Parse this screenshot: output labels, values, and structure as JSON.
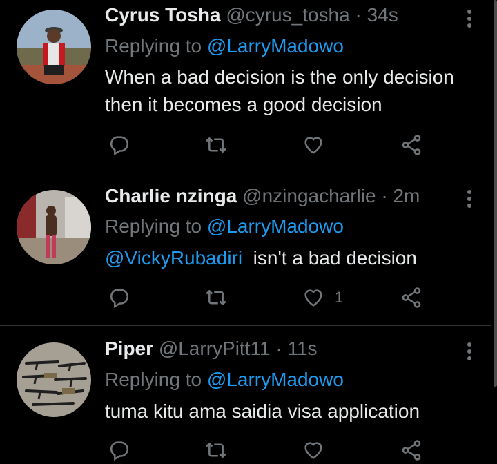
{
  "colors": {
    "accent": "#1d9bf0",
    "muted": "#71767b",
    "text": "#e7e9ea",
    "background": "#000000"
  },
  "tweets": [
    {
      "name": "Cyrus Tosha",
      "handle": "@cyrus_tosha",
      "sep": "·",
      "time": "34s",
      "reply_prefix": "Replying to",
      "reply_to": "@LarryMadowo",
      "lines": [
        "When a bad decision is the only decision",
        "then it becomes a good decision"
      ],
      "like_count": ""
    },
    {
      "name": "Charlie nzinga",
      "handle": "@nzingacharlie",
      "sep": "·",
      "time": "2m",
      "reply_prefix": "Replying to",
      "reply_to": "@LarryMadowo",
      "mention": "@VickyRubadiri",
      "text": "isn't a bad decision",
      "like_count": "1"
    },
    {
      "name": "Piper",
      "handle": "@LarryPitt11",
      "sep": "·",
      "time": "11s",
      "reply_prefix": "Replying to",
      "reply_to": "@LarryMadowo",
      "text": "tuma kitu ama saidia visa application",
      "like_count": ""
    }
  ],
  "icons": [
    "reply-icon",
    "retweet-icon",
    "like-icon",
    "share-icon",
    "more-icon"
  ]
}
